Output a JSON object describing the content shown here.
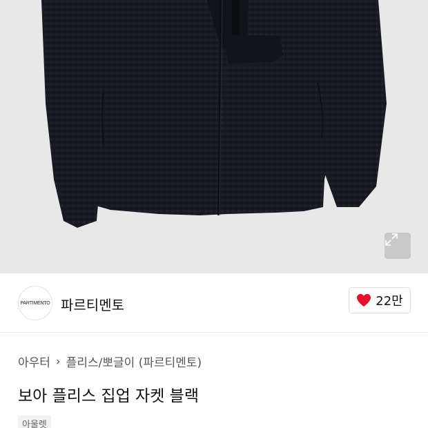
{
  "product": {
    "image_alt": "black sherpa fleece zip jacket",
    "brand": {
      "logo_text": "PARTIMENTO",
      "name": "파르티멘토"
    },
    "likes": {
      "count": "22만",
      "icon": "heart-icon",
      "color": "#e8112d"
    },
    "breadcrumb": {
      "category": "아우터",
      "separator": "›",
      "subcategory": "플리스/뽀글이 (파르티멘토)"
    },
    "title": "보아 플리스 집업 자켓 블랙",
    "badge": "아울렛"
  },
  "colors": {
    "image_bg": "#e8e8e8",
    "jacket": "#1a1c24"
  }
}
